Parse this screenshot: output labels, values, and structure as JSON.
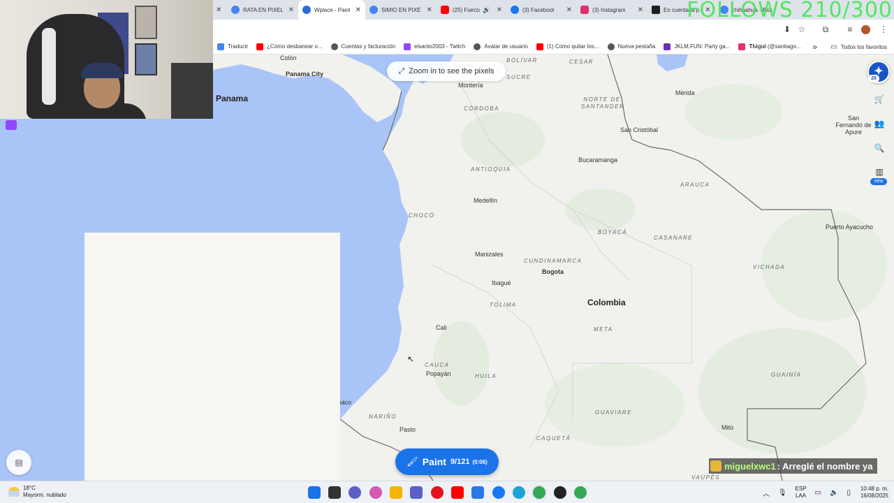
{
  "overlay": {
    "follows_text": "FOLLOWS 210/300"
  },
  "tabs": [
    {
      "label": "RATA EN PIXELE",
      "icon": "google-icon",
      "active": false
    },
    {
      "label": "Wplace - Paint",
      "icon": "globe-icon",
      "active": true
    },
    {
      "label": "SIMIO EN PIXE",
      "icon": "google-icon",
      "active": false
    },
    {
      "label": "(25) Fuerza",
      "icon": "youtube-icon",
      "active": false
    },
    {
      "label": "(3) Facebook",
      "icon": "facebook-icon",
      "active": false
    },
    {
      "label": "(3) Instagram",
      "icon": "instagram-icon",
      "active": false
    },
    {
      "label": "En cuenta la p",
      "icon": "kick-icon",
      "active": false
    },
    {
      "label": "chihuahua - Bús",
      "icon": "google-icon",
      "active": false
    }
  ],
  "bookmarks": [
    {
      "label": "Traducir",
      "icon": "translate-icon",
      "color": "#4285f4"
    },
    {
      "label": "¿Cómo desbanear o...",
      "icon": "youtube-icon",
      "color": "#ff0000"
    },
    {
      "label": "Cuentas y facturación",
      "icon": "globe-icon",
      "color": "#555555"
    },
    {
      "label": "elsanto2003 - Twitch",
      "icon": "twitch-icon",
      "color": "#9146ff"
    },
    {
      "label": "Avatar de usuario",
      "icon": "globe-icon",
      "color": "#555555"
    },
    {
      "label": "(1) Como quitar los...",
      "icon": "youtube-icon",
      "color": "#ff0000"
    },
    {
      "label": "Nueva pestaña",
      "icon": "globe-icon",
      "color": "#555555"
    },
    {
      "label": "JKLM.FUN: Party ga...",
      "icon": "jklm-icon",
      "color": "#6b2fb3"
    },
    {
      "label": "𝐓𝐡𝐢𝐠𝐮𝐢 (@santiago...",
      "icon": "instagram-icon",
      "color": "#e1306c"
    }
  ],
  "bookmarks_all": "Todos los favoritos",
  "wplace": {
    "zoom_hint": "Zoom in to see the pixels",
    "avatar_badge": "28",
    "new_badge": "new",
    "paint_label": "Paint",
    "paint_count": "9/121",
    "paint_timer": "(0:06)"
  },
  "map": {
    "countries": [
      {
        "name": "Panama",
        "key": "panama"
      },
      {
        "name": "Colombia",
        "key": "colombia"
      }
    ],
    "cities": [
      {
        "name": "Colón",
        "key": "colon"
      },
      {
        "name": "Panama City",
        "key": "panama-city",
        "bold": true
      },
      {
        "name": "Montería",
        "key": "monteria"
      },
      {
        "name": "Mérida",
        "key": "merida"
      },
      {
        "name": "San Cristóbal",
        "key": "san-cristobal"
      },
      {
        "name": "San Fernando de Apure",
        "key": "san-fernando"
      },
      {
        "name": "Bucaramanga",
        "key": "bucaramanga"
      },
      {
        "name": "Medellín",
        "key": "medellin"
      },
      {
        "name": "Puerto Ayacucho",
        "key": "puerto-ayacucho"
      },
      {
        "name": "Manizales",
        "key": "manizales"
      },
      {
        "name": "Bogota",
        "key": "bogota",
        "bold": true
      },
      {
        "name": "Ibagué",
        "key": "ibague"
      },
      {
        "name": "Cali",
        "key": "cali"
      },
      {
        "name": "Popayán",
        "key": "popayan"
      },
      {
        "name": "Tumaco",
        "key": "tumaco"
      },
      {
        "name": "Pasto",
        "key": "pasto"
      },
      {
        "name": "Mitú",
        "key": "mitu"
      }
    ],
    "departments": [
      {
        "name": "BOLÍVAR",
        "key": "bolivar"
      },
      {
        "name": "CESAR",
        "key": "cesar"
      },
      {
        "name": "SUCRE",
        "key": "sucre"
      },
      {
        "name": "CÓRDOBA",
        "key": "cordoba"
      },
      {
        "name": "NORTE DE SANTANDER",
        "key": "norte-santander"
      },
      {
        "name": "ANTIOQUIA",
        "key": "antioquia"
      },
      {
        "name": "ARAUCA",
        "key": "arauca"
      },
      {
        "name": "CHOCÓ",
        "key": "choco"
      },
      {
        "name": "BOYACÁ",
        "key": "boyaca"
      },
      {
        "name": "CASANARE",
        "key": "casanare"
      },
      {
        "name": "CUNDINAMARCA",
        "key": "cundinamarca"
      },
      {
        "name": "VICHADA",
        "key": "vichada"
      },
      {
        "name": "TOLIMA",
        "key": "tolima"
      },
      {
        "name": "META",
        "key": "meta"
      },
      {
        "name": "CAUCA",
        "key": "cauca"
      },
      {
        "name": "HUILA",
        "key": "huila"
      },
      {
        "name": "GUAINÍA",
        "key": "guainia"
      },
      {
        "name": "NARIÑO",
        "key": "narino"
      },
      {
        "name": "GUAVIARE",
        "key": "guaviare"
      },
      {
        "name": "CAQUETÁ",
        "key": "caqueta"
      },
      {
        "name": "VAUPÉS",
        "key": "vaupes"
      }
    ]
  },
  "chat": {
    "user": "miguelxwc1",
    "message": ": Arreglé el nombre ya"
  },
  "taskbar": {
    "temp": "18°C",
    "weather": "Mayorm. nublado",
    "lang_top": "ESP",
    "lang_bottom": "LAA",
    "time": "10:48 p. m.",
    "date": "16/08/2025",
    "apps": [
      {
        "icon": "windows-start-icon",
        "color": "#1a73e8"
      },
      {
        "icon": "task-view-icon",
        "color": "#333333"
      },
      {
        "icon": "chat-icon",
        "color": "#5b5fc7"
      },
      {
        "icon": "copilot-icon",
        "color": "#d35ab3"
      },
      {
        "icon": "file-explorer-icon",
        "color": "#f4b400"
      },
      {
        "icon": "teams-icon",
        "color": "#5b5fc7"
      },
      {
        "icon": "opera-icon",
        "color": "#e4141e"
      },
      {
        "icon": "youtube-icon",
        "color": "#ff0000"
      },
      {
        "icon": "store-icon",
        "color": "#2b78e4"
      },
      {
        "icon": "facebook-icon",
        "color": "#1877f2"
      },
      {
        "icon": "edge-icon",
        "color": "#1fa2d4"
      },
      {
        "icon": "chrome-icon",
        "color": "#34a853"
      },
      {
        "icon": "obs-icon",
        "color": "#222222"
      },
      {
        "icon": "chrome-alt-icon",
        "color": "#34a853"
      }
    ]
  }
}
